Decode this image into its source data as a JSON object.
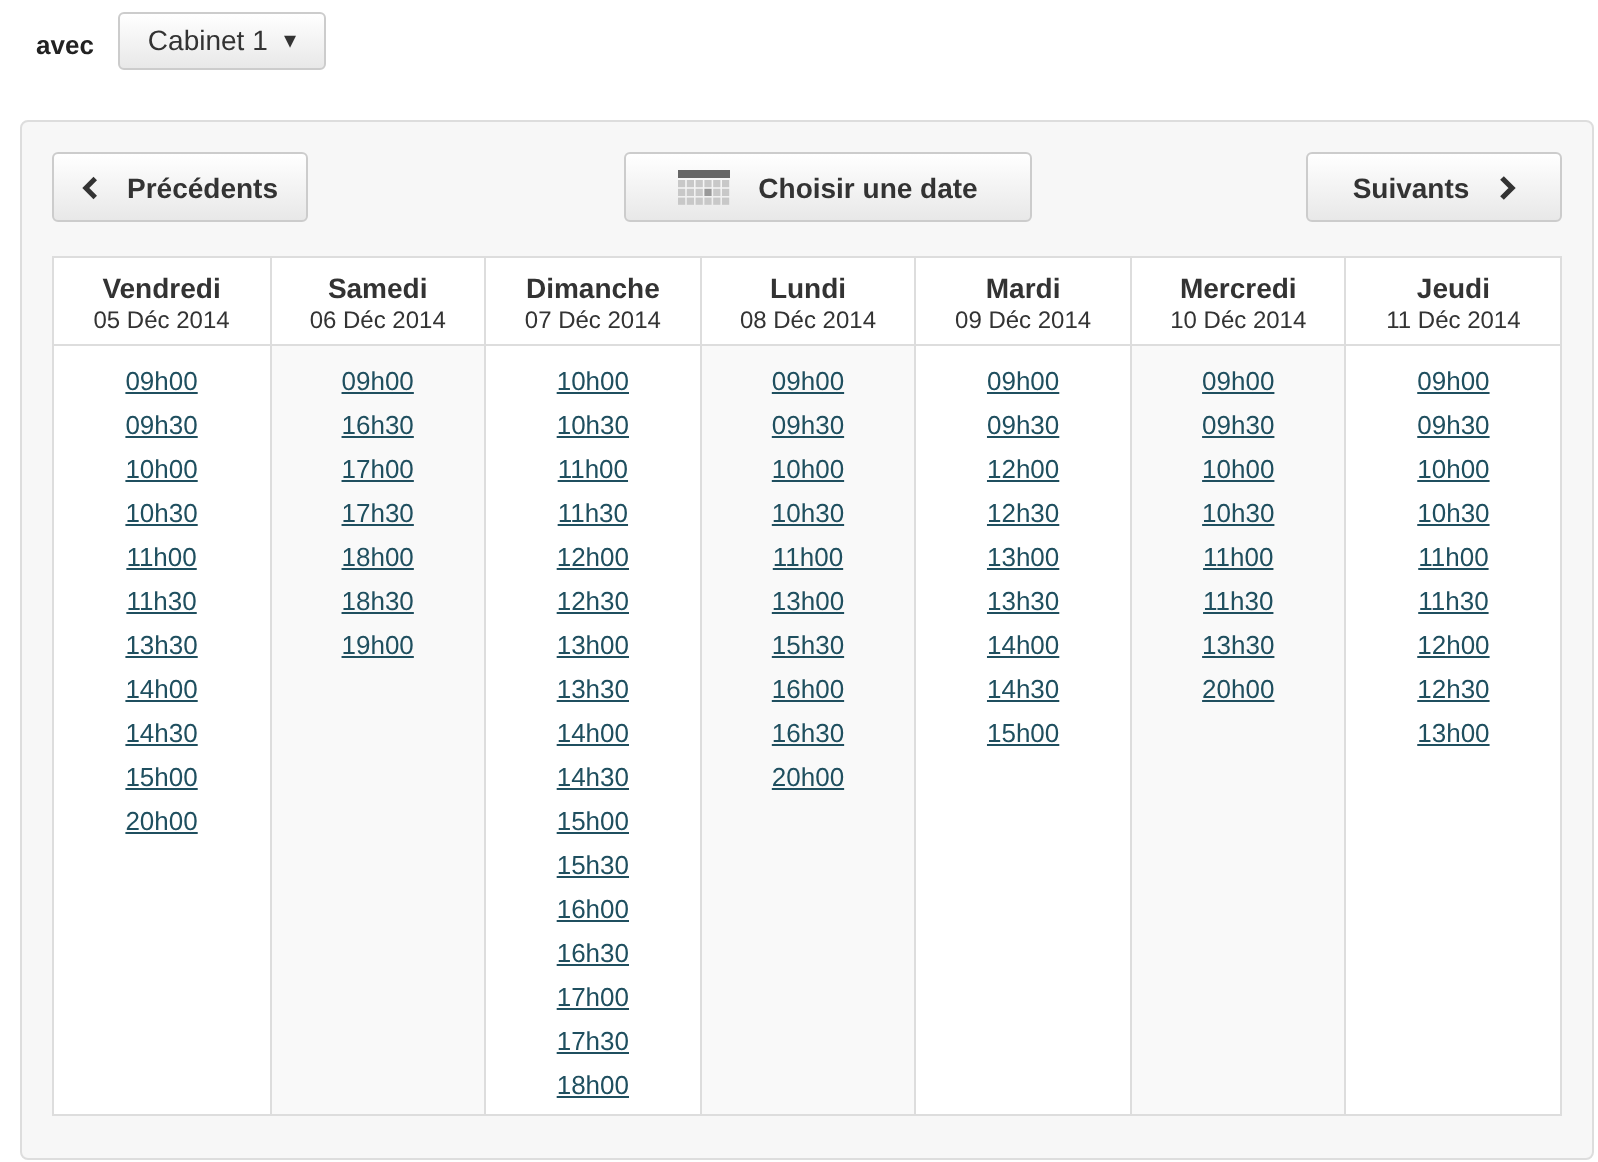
{
  "practitioner": {
    "label": "avec",
    "dropdown": "Cabinet 1",
    "caret": "▾"
  },
  "nav": {
    "previous": "Précédents",
    "choose_date": "Choisir une date",
    "next": "Suivants"
  },
  "days": [
    {
      "name": "Vendredi",
      "date": "05 Déc 2014",
      "slots": [
        "09h00",
        "09h30",
        "10h00",
        "10h30",
        "11h00",
        "11h30",
        "13h30",
        "14h00",
        "14h30",
        "15h00",
        "20h00"
      ]
    },
    {
      "name": "Samedi",
      "date": "06 Déc 2014",
      "slots": [
        "09h00",
        "16h30",
        "17h00",
        "17h30",
        "18h00",
        "18h30",
        "19h00"
      ]
    },
    {
      "name": "Dimanche",
      "date": "07 Déc 2014",
      "slots": [
        "10h00",
        "10h30",
        "11h00",
        "11h30",
        "12h00",
        "12h30",
        "13h00",
        "13h30",
        "14h00",
        "14h30",
        "15h00",
        "15h30",
        "16h00",
        "16h30",
        "17h00",
        "17h30",
        "18h00"
      ]
    },
    {
      "name": "Lundi",
      "date": "08 Déc 2014",
      "slots": [
        "09h00",
        "09h30",
        "10h00",
        "10h30",
        "11h00",
        "13h00",
        "15h30",
        "16h00",
        "16h30",
        "20h00"
      ]
    },
    {
      "name": "Mardi",
      "date": "09 Déc 2014",
      "slots": [
        "09h00",
        "09h30",
        "12h00",
        "12h30",
        "13h00",
        "13h30",
        "14h00",
        "14h30",
        "15h00"
      ]
    },
    {
      "name": "Mercredi",
      "date": "10 Déc 2014",
      "slots": [
        "09h00",
        "09h30",
        "10h00",
        "10h30",
        "11h00",
        "11h30",
        "13h30",
        "20h00"
      ]
    },
    {
      "name": "Jeudi",
      "date": "11 Déc 2014",
      "slots": [
        "09h00",
        "09h30",
        "10h00",
        "10h30",
        "11h00",
        "11h30",
        "12h00",
        "12h30",
        "13h00"
      ]
    }
  ]
}
